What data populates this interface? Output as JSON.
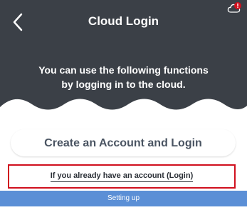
{
  "header": {
    "title": "Cloud Login",
    "back_icon": "chevron-left-icon",
    "status_icon": "cloud-alert-icon"
  },
  "main": {
    "description_line1": "You can use the following functions",
    "description_line2": "by logging in to the cloud.",
    "create_button_label": "Create an Account and Login",
    "login_link_label": "If you already have an account (Login)"
  },
  "footer": {
    "settings_label": "Setting up"
  },
  "colors": {
    "background_dark": "#3b4047",
    "content_light": "#ffffff",
    "highlight_border": "#d0101e",
    "settings_bar": "#5b8fd6"
  }
}
